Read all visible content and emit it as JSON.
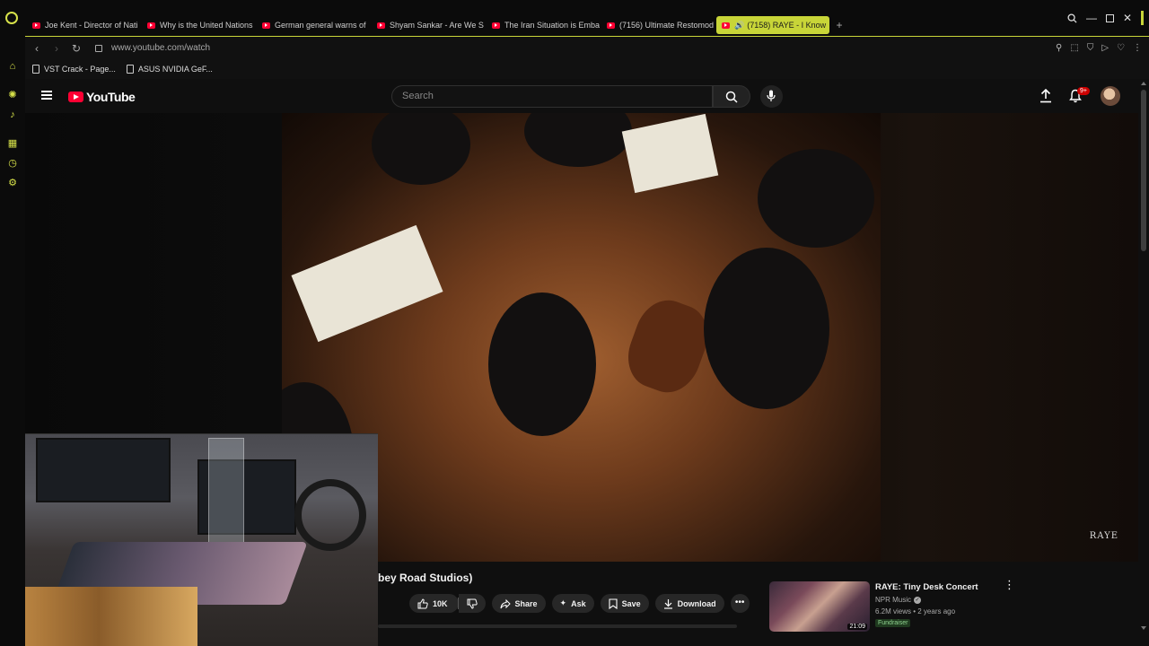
{
  "browser": {
    "tabs": [
      {
        "label": "Joe Kent - Director of Nati"
      },
      {
        "label": "Why is the United Nations"
      },
      {
        "label": "German general warns of"
      },
      {
        "label": "Shyam Sankar - Are We S"
      },
      {
        "label": "The Iran Situation is Emba"
      },
      {
        "label": "(7156) Ultimate Restomod"
      },
      {
        "label": "(7158) RAYE - I Know"
      }
    ],
    "new_tab": "+",
    "url": "www.youtube.com/watch",
    "bookmarks": [
      {
        "label": "VST Crack - Page..."
      },
      {
        "label": "ASUS NVIDIA GeF..."
      }
    ],
    "accent_color": "#c8d538"
  },
  "youtube": {
    "logo_text": "YouTube",
    "search_placeholder": "Search",
    "notification_badge": "9+",
    "video_watermark": "RAYE",
    "video_title": "bey Road Studios)",
    "actions": {
      "likes": "10K",
      "share": "Share",
      "ask": "Ask",
      "save": "Save",
      "download": "Download",
      "more": "•••"
    },
    "recommendation": {
      "title": "RAYE: Tiny Desk Concert",
      "channel": "NPR Music",
      "meta": "6.2M views • 2 years ago",
      "badge": "Fundraiser",
      "duration": "21:09"
    },
    "brand_color": "#ff0033"
  }
}
